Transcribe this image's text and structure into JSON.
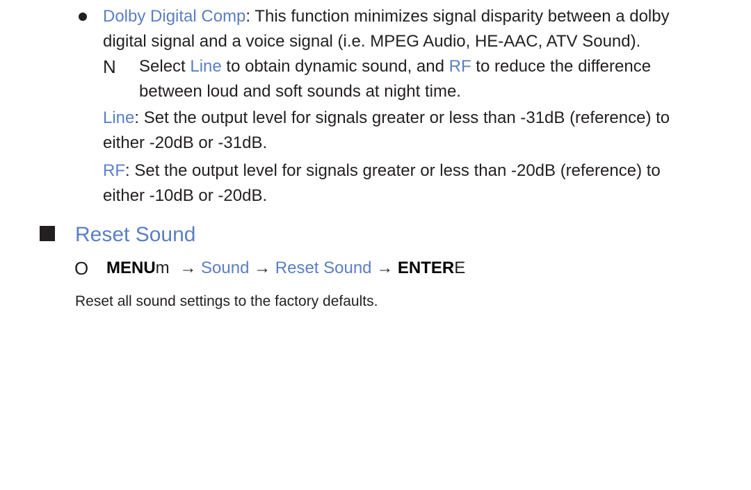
{
  "bullet": {
    "term": "Dolby Digital Comp",
    "line1_rest": ": This function minimizes signal disparity between a dolby",
    "line2": "digital signal and a voice signal (i.e. MPEG Audio, HE-AAC, ATV Sound)."
  },
  "note": {
    "glyph": "N",
    "text_a": "Select ",
    "term1": "Line",
    "text_b": " to obtain dynamic sound, and ",
    "term2": "RF",
    "text_c": " to reduce the difference",
    "line2": "between loud and soft sounds at night time."
  },
  "line_desc": {
    "term": "Line",
    "line1_rest": ": Set the output level for signals greater or less than -31dB (reference) to",
    "line2": "either -20dB or -31dB."
  },
  "rf_desc": {
    "term": "RF",
    "line1_rest": ": Set the output level for signals greater or less than -20dB (reference) to",
    "line2": "either -10dB or -20dB."
  },
  "section": {
    "title": "Reset Sound",
    "path_glyph": "O",
    "path": {
      "menu": "MENU",
      "menu_suffix": "m",
      "arrow1": " → ",
      "step1": "Sound",
      "arrow2": " → ",
      "step2": "Reset Sound",
      "arrow3": " → ",
      "enter": "ENTER",
      "enter_suffix": "E"
    },
    "description": "Reset all sound settings to the factory defaults."
  },
  "colors": {
    "accent": "#5b7fc4",
    "text": "#231f20"
  }
}
